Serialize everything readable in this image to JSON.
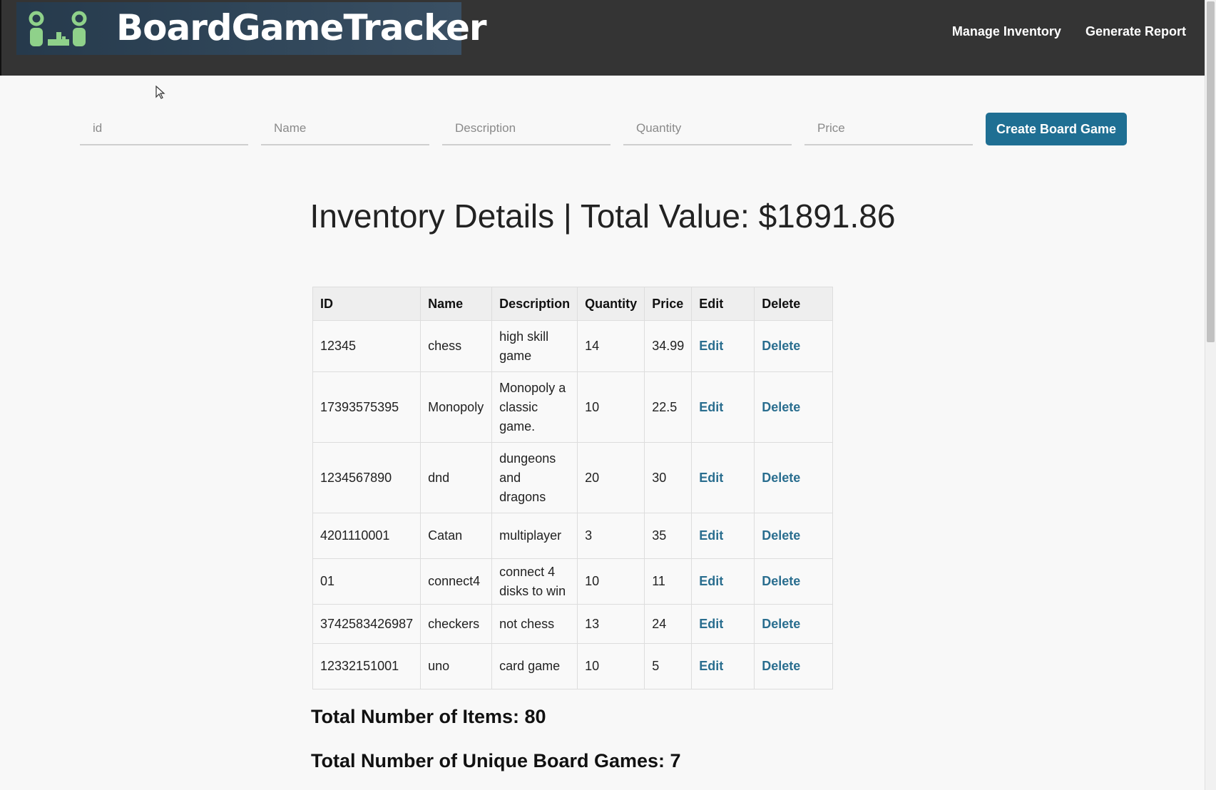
{
  "navbar": {
    "brand": "BoardGameTracker",
    "links": [
      "Manage Inventory",
      "Generate Report"
    ]
  },
  "form": {
    "placeholders": {
      "id": "id",
      "name": "Name",
      "description": "Description",
      "quantity": "Quantity",
      "price": "Price"
    },
    "submit_label": "Create Board Game"
  },
  "title": "Inventory Details | Total Value: $1891.86",
  "table": {
    "headers": [
      "ID",
      "Name",
      "Description",
      "Quantity",
      "Price",
      "Edit",
      "Delete"
    ],
    "rows": [
      {
        "id": "12345",
        "name": "chess",
        "description": "high skill game",
        "quantity": "14",
        "price": "34.99"
      },
      {
        "id": "17393575395",
        "name": "Monopoly",
        "description": "Monopoly a classic game.",
        "quantity": "10",
        "price": "22.5"
      },
      {
        "id": "1234567890",
        "name": "dnd",
        "description": "dungeons and dragons",
        "quantity": "20",
        "price": "30"
      },
      {
        "id": "4201110001",
        "name": "Catan",
        "description": "multiplayer",
        "quantity": "3",
        "price": "35"
      },
      {
        "id": "01",
        "name": "connect4",
        "description": "connect 4 disks to win",
        "quantity": "10",
        "price": "11"
      },
      {
        "id": "3742583426987",
        "name": "checkers",
        "description": "not chess",
        "quantity": "13",
        "price": "24"
      },
      {
        "id": "12332151001",
        "name": "uno",
        "description": "card game",
        "quantity": "10",
        "price": "5"
      }
    ],
    "edit_label": "Edit",
    "delete_label": "Delete"
  },
  "summary": {
    "total_items": "Total Number of Items: 80",
    "unique_games": "Total Number of Unique Board Games: 7"
  },
  "colors": {
    "navbar_bg": "#343434",
    "accent": "#1f6f93",
    "action_link": "#2a6e8f",
    "logo_green": "#8fd18a"
  },
  "icons": [
    "board-game-players-logo-icon",
    "cursor-pointer-icon"
  ]
}
